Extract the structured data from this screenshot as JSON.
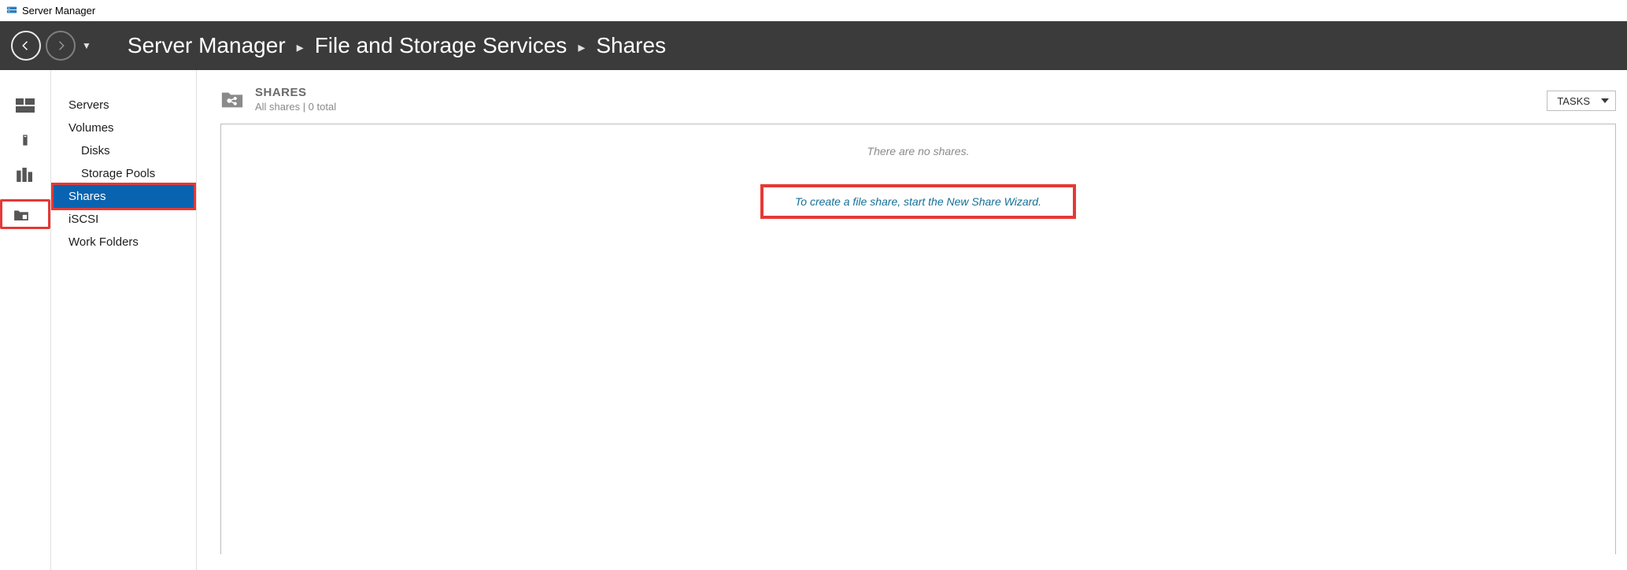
{
  "app": {
    "title": "Server Manager"
  },
  "breadcrumbs": {
    "main": "Server Manager",
    "section": "File and Storage Services",
    "page": "Shares"
  },
  "rail": {
    "icons": [
      "dashboard",
      "local-server",
      "all-servers",
      "file-storage"
    ]
  },
  "sidebar": {
    "items": [
      {
        "label": "Servers",
        "indent": false,
        "selected": false
      },
      {
        "label": "Volumes",
        "indent": false,
        "selected": false
      },
      {
        "label": "Disks",
        "indent": true,
        "selected": false
      },
      {
        "label": "Storage Pools",
        "indent": true,
        "selected": false
      },
      {
        "label": "Shares",
        "indent": false,
        "selected": true
      },
      {
        "label": "iSCSI",
        "indent": false,
        "selected": false
      },
      {
        "label": "Work Folders",
        "indent": false,
        "selected": false
      }
    ]
  },
  "section": {
    "title": "SHARES",
    "subtitle": "All shares | 0 total",
    "tasks_label": "TASKS"
  },
  "content": {
    "empty_message": "There are no shares.",
    "wizard_hint": "To create a file share, start the New Share Wizard."
  }
}
